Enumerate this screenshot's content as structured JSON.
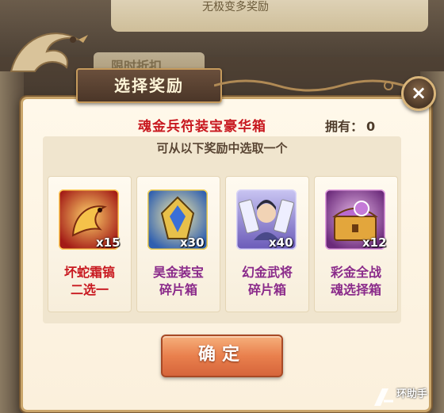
{
  "background": {
    "banner_text": "无极变多奖励",
    "ghost_tab": "限时折扣"
  },
  "dialog": {
    "title": "选择奖励",
    "close_symbol": "×",
    "chest_name": "魂金兵符装宝豪华箱",
    "owned_label": "拥有：",
    "owned_value": "0",
    "instruction": "可从以下奖励中选取一个",
    "confirm_label": "确定"
  },
  "rewards": [
    {
      "name_line1": "坏蛇霜镐",
      "name_line2": "二选一",
      "quantity": "x15",
      "name_color": "#c8181f",
      "icon": "serpent-weapon-icon"
    },
    {
      "name_line1": "昊金装宝",
      "name_line2": "碎片箱",
      "quantity": "x30",
      "name_color": "#8a2a8a",
      "icon": "gold-armor-shard-icon"
    },
    {
      "name_line1": "幻金武将",
      "name_line2": "碎片箱",
      "quantity": "x40",
      "name_color": "#8a2a8a",
      "icon": "hero-shard-icon"
    },
    {
      "name_line1": "彩金全战",
      "name_line2": "魂选择箱",
      "quantity": "x12",
      "name_color": "#8a2a8a",
      "icon": "soul-chest-icon"
    }
  ],
  "watermark": {
    "text": "环助手"
  }
}
